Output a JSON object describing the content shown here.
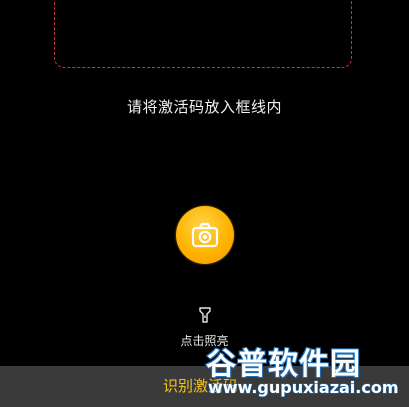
{
  "scanner": {
    "hint": "请将激活码放入框线内"
  },
  "camera": {
    "icon": "camera-icon",
    "accent": "#ffb300"
  },
  "torch": {
    "icon": "flashlight-icon",
    "label": "点击照亮"
  },
  "bottom_bar": {
    "tab_label": "识别激活码"
  },
  "watermark": {
    "title": "谷普软件园",
    "url": "www.gupuxiazai.com"
  },
  "colors": {
    "frame": "#c2383c",
    "tab_active": "#f5c518",
    "background": "#000000"
  }
}
